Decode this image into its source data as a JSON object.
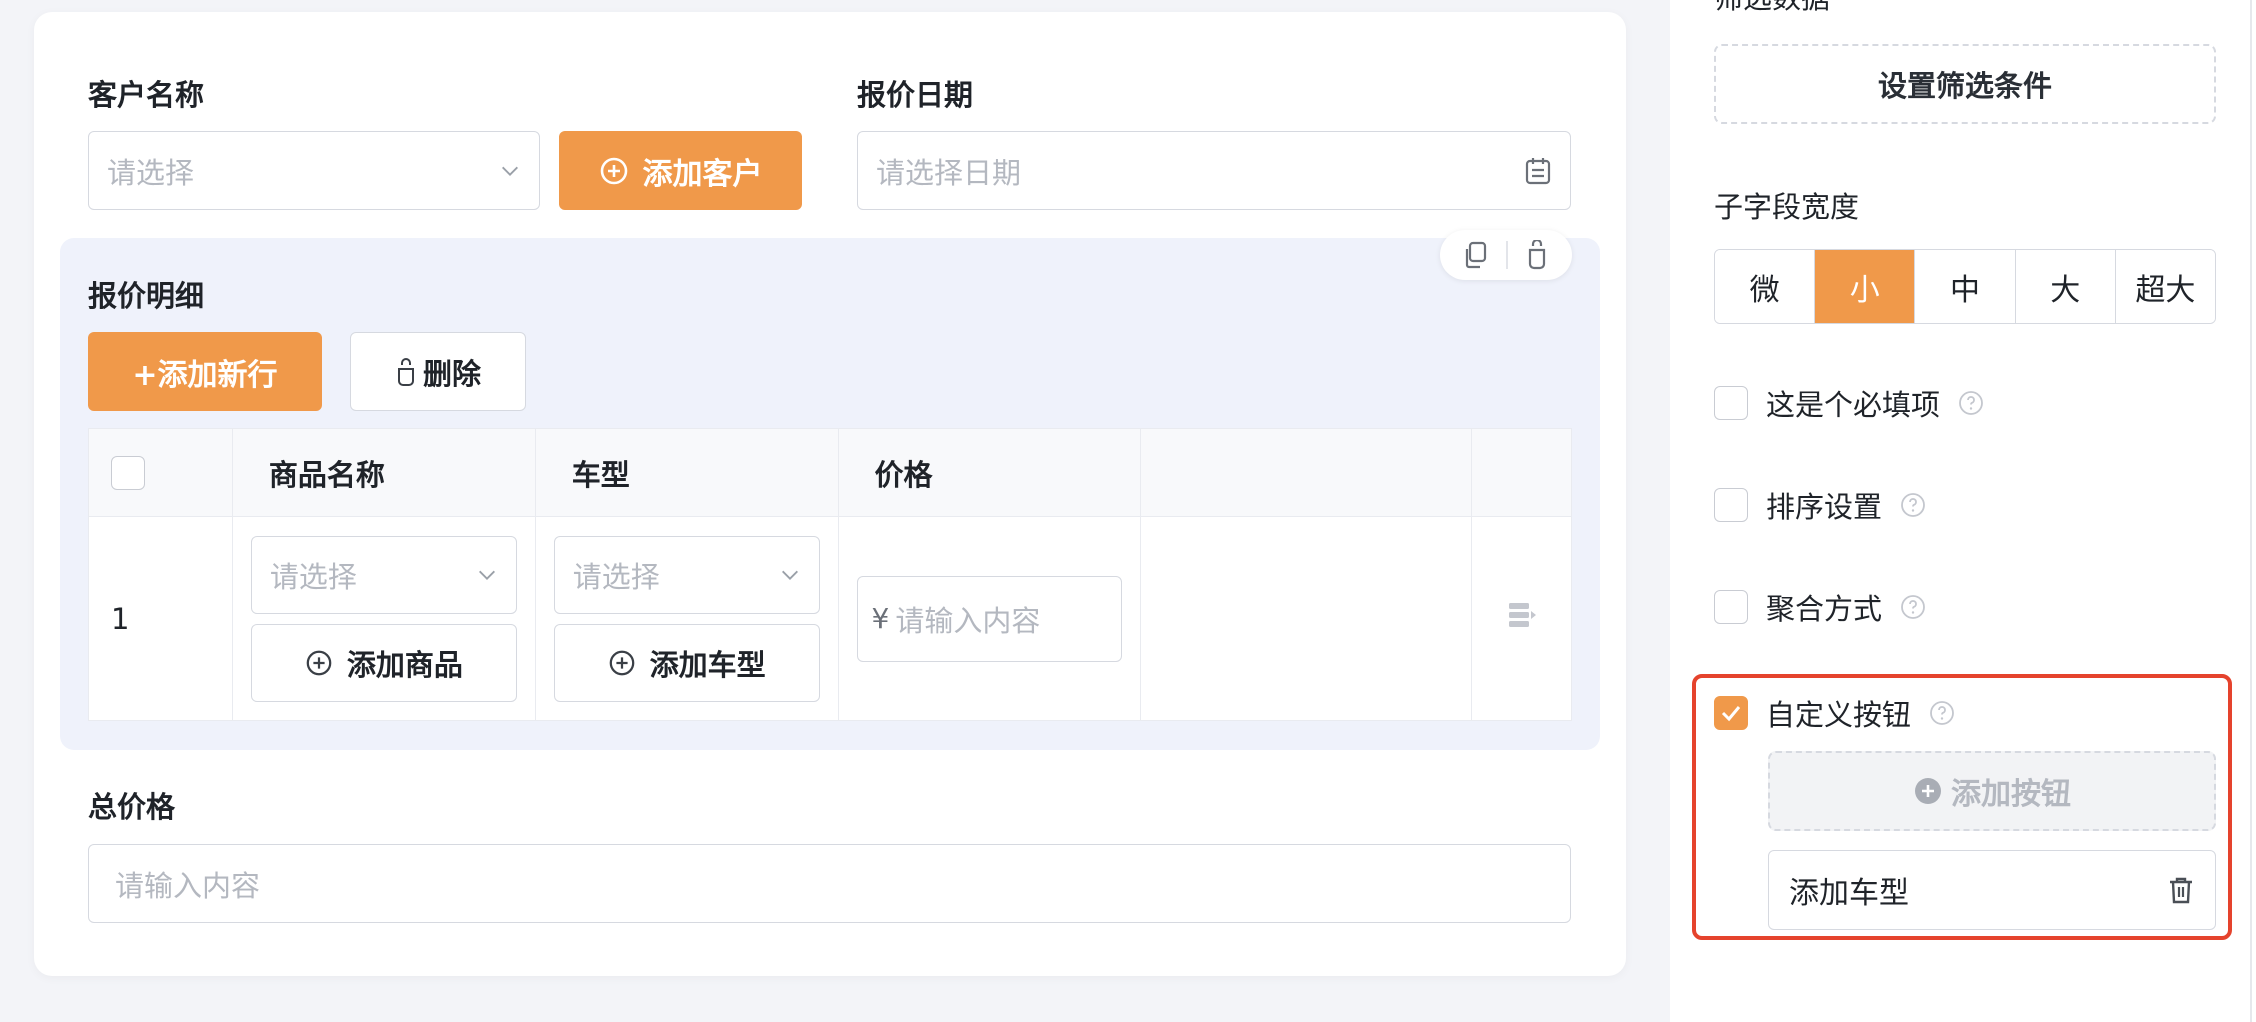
{
  "form": {
    "customer": {
      "label": "客户名称",
      "placeholder": "请选择",
      "add_button": "添加客户"
    },
    "quote_date": {
      "label": "报价日期",
      "placeholder": "请选择日期"
    },
    "detail": {
      "label": "报价明细",
      "add_row_button": "+添加新行",
      "delete_button": "删除",
      "columns": [
        "商品名称",
        "车型",
        "价格"
      ],
      "rows": [
        {
          "index": "1",
          "product_placeholder": "请选择",
          "product_add_button": "添加商品",
          "model_placeholder": "请选择",
          "model_add_button": "添加车型",
          "price_prefix": "¥",
          "price_placeholder": "请输入内容"
        }
      ]
    },
    "total": {
      "label": "总价格",
      "placeholder": "请输入内容"
    }
  },
  "settings": {
    "filter": {
      "label": "筛选数据",
      "button": "设置筛选条件"
    },
    "sub_field_width": {
      "label": "子字段宽度",
      "options": [
        "微",
        "小",
        "中",
        "大",
        "超大"
      ],
      "selected": "小"
    },
    "required": {
      "label": "这是个必填项",
      "checked": false
    },
    "sorting": {
      "label": "排序设置",
      "checked": false
    },
    "aggregation": {
      "label": "聚合方式",
      "checked": false
    },
    "custom_button": {
      "label": "自定义按钮",
      "checked": true,
      "add_button": "添加按钮",
      "items": [
        "添加车型"
      ]
    }
  },
  "colors": {
    "accent": "#f0994a",
    "highlight_border": "#e5432d",
    "panel_bg": "#eff2fb",
    "page_bg": "#f3f4f8"
  }
}
